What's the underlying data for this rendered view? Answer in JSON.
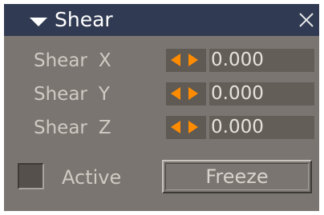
{
  "panel": {
    "title": "Shear",
    "collapse_icon": "triangle-down-icon",
    "close_icon": "close-x-icon",
    "accent_color": "#ff8c00",
    "title_bar_color": "#303a52"
  },
  "rows": [
    {
      "label": "Shear",
      "axis": "X",
      "value": "0.000"
    },
    {
      "label": "Shear",
      "axis": "Y",
      "value": "0.000"
    },
    {
      "label": "Shear",
      "axis": "Z",
      "value": "0.000"
    }
  ],
  "active": {
    "label": "Active",
    "checked": false
  },
  "freeze": {
    "label": "Freeze"
  }
}
